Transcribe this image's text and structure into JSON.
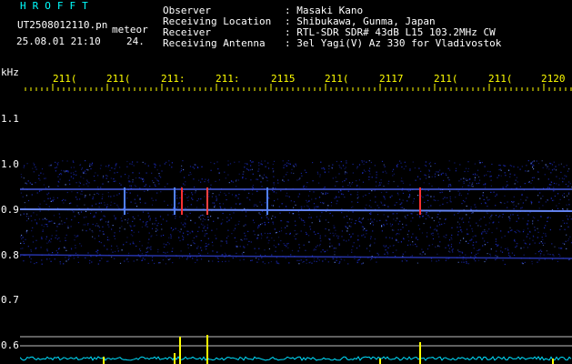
{
  "header": {
    "brand": "HROFFT",
    "filename": "UT2508012110.pn",
    "filename_suffix": "meteor",
    "datetime": "25.08.01 21:10",
    "datetime_extra": "24."
  },
  "info": [
    {
      "label": "Observer",
      "value": ": Masaki Kano"
    },
    {
      "label": "Receiving Location",
      "value": ": Shibukawa, Gunma, Japan"
    },
    {
      "label": "Receiver",
      "value": ": RTL-SDR SDR# 43dB L15 103.2MHz CW"
    },
    {
      "label": "Receiving Antenna",
      "value": ": 3el Yagi(V) Az 330 for Vladivostok"
    }
  ],
  "axis": {
    "y_unit": "kHz",
    "x_ticks": [
      "211(",
      "211(",
      "211:",
      "211:",
      "2115",
      "211(",
      "2117",
      "211(",
      "211(",
      "2120"
    ],
    "y_ticks": [
      "1.1",
      "1.0",
      "0.9",
      "0.8",
      "0.7",
      "0.6"
    ]
  },
  "colors": {
    "background": "#000000",
    "noise": "#1020c0",
    "trace": "#6080ff",
    "meteor": "#ff3030",
    "amplitude_trace": "#00e0ff",
    "amplitude_peak": "#ffff00"
  }
}
